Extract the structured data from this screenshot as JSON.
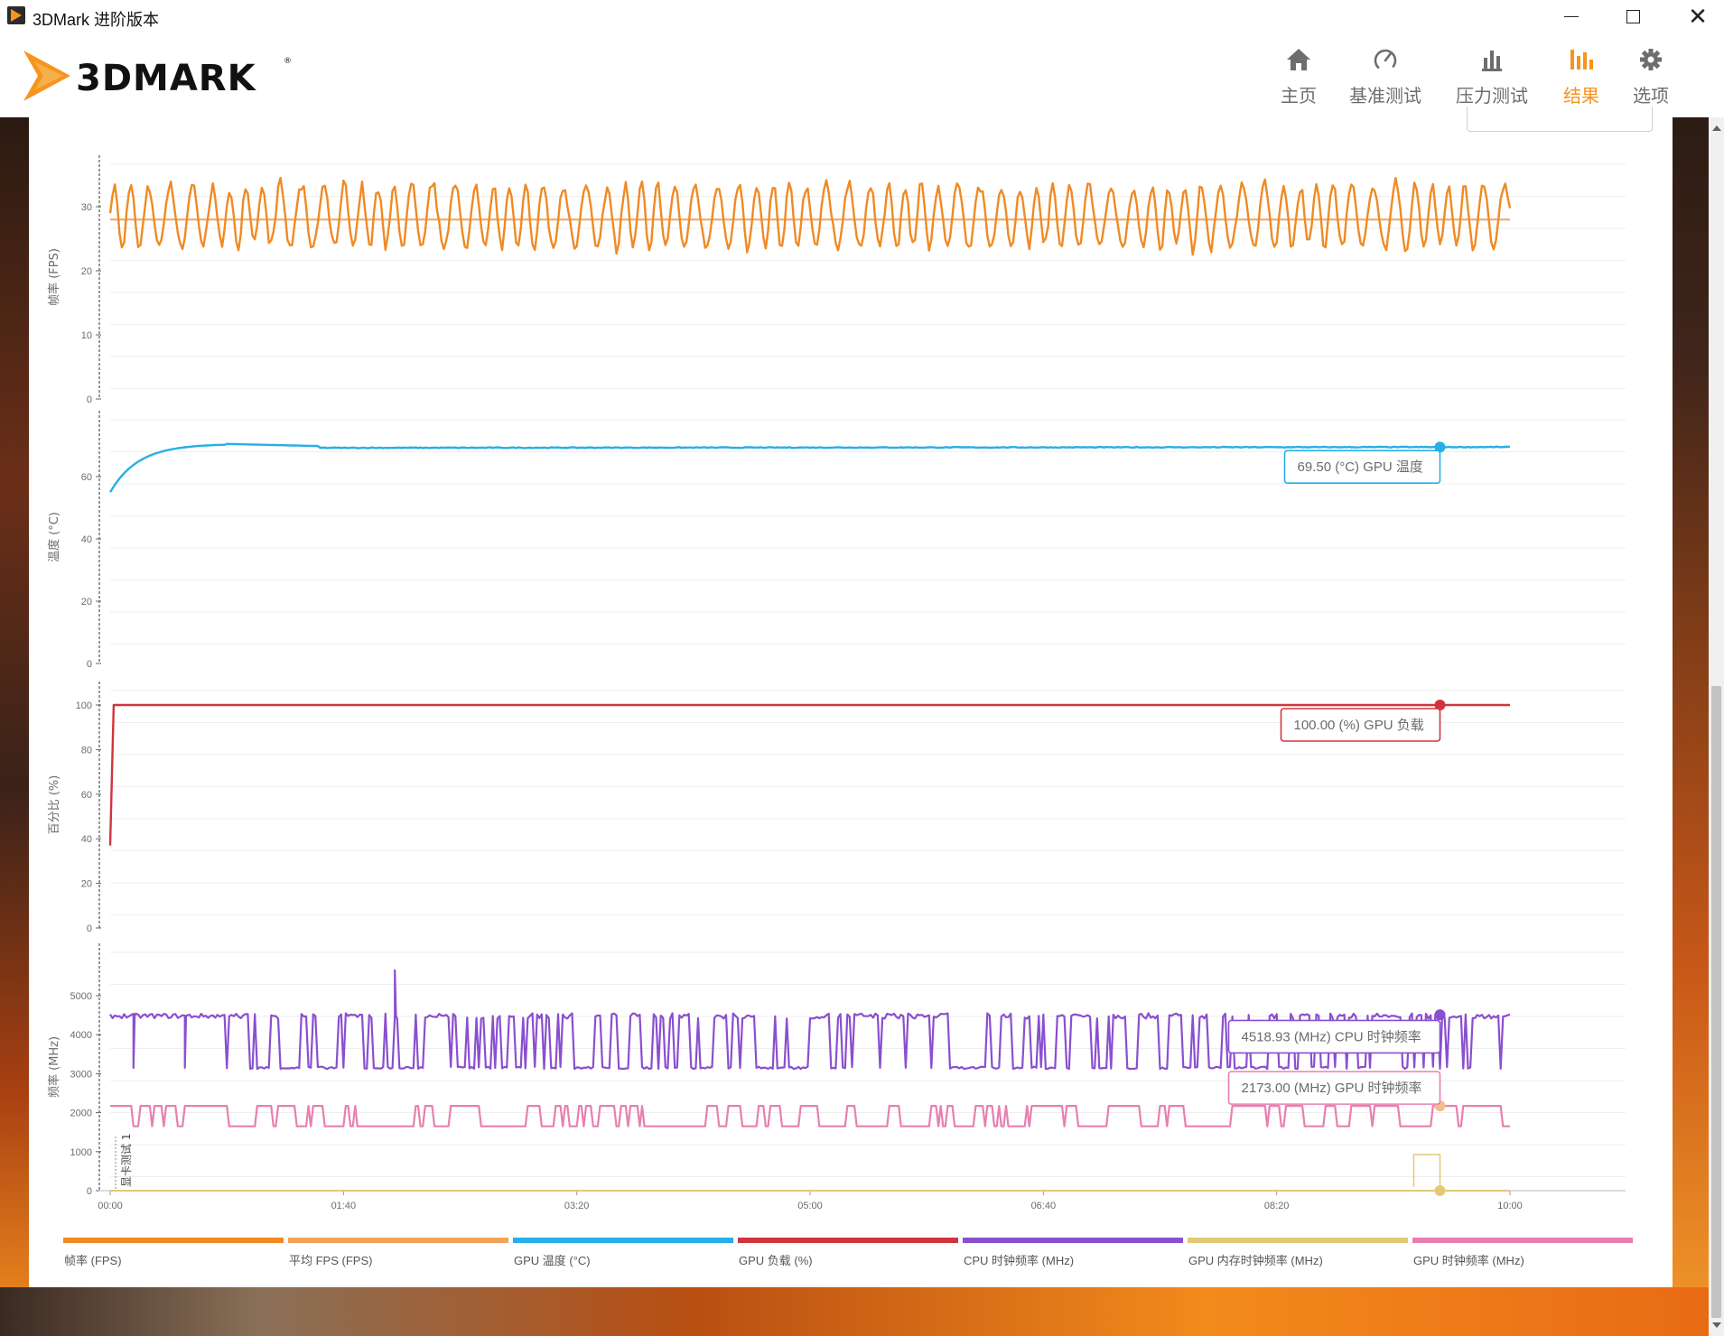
{
  "window": {
    "title": "3DMark 进阶版本"
  },
  "nav": {
    "items": [
      {
        "label": "主页",
        "icon": "home-icon"
      },
      {
        "label": "基准测试",
        "icon": "gauge-icon"
      },
      {
        "label": "压力测试",
        "icon": "bar-chart-icon"
      },
      {
        "label": "结果",
        "icon": "results-icon",
        "active": true
      },
      {
        "label": "选项",
        "icon": "gear-icon"
      }
    ],
    "active_color": "#f7941d"
  },
  "chart_data": {
    "type": "line",
    "x_ticks": [
      "00:00",
      "01:40",
      "03:20",
      "05:00",
      "06:40",
      "08:20",
      "10:00"
    ],
    "xlim_seconds": [
      0,
      600
    ],
    "panels": [
      {
        "ylabel": "帧率 (FPS)",
        "yticks": [
          0,
          10,
          20,
          30
        ],
        "ylim": [
          0,
          30
        ],
        "series": [
          {
            "name": "帧率 (FPS)",
            "color": "#f08a24",
            "pattern": "oscillating",
            "min": 23,
            "max": 34
          },
          {
            "name": "平均 FPS (FPS)",
            "color": "#f5a25a",
            "pattern": "flat",
            "value": 28
          }
        ]
      },
      {
        "ylabel": "温度 (°C)",
        "yticks": [
          0,
          20,
          40,
          60
        ],
        "ylim": [
          0,
          70
        ],
        "series": [
          {
            "name": "GPU 温度 (°C)",
            "color": "#29aee6",
            "pattern": "warmup",
            "start": 55,
            "peak": 70.5,
            "value": 69.5
          }
        ]
      },
      {
        "ylabel": "百分比 (%)",
        "yticks": [
          0,
          20,
          40,
          60,
          80,
          100
        ],
        "ylim": [
          0,
          100
        ],
        "series": [
          {
            "name": "GPU 负载 (%)",
            "color": "#d0353d",
            "pattern": "step",
            "start": 37,
            "value": 100
          }
        ]
      },
      {
        "ylabel": "频率 (MHz)",
        "yticks": [
          0,
          1000,
          2000,
          3000,
          4000,
          5000
        ],
        "ylim": [
          0,
          5000
        ],
        "series": [
          {
            "name": "CPU 时钟频率 (MHz)",
            "color": "#8a4fd0",
            "pattern": "square",
            "low": 3150,
            "high": 4480,
            "spike": 5650
          },
          {
            "name": "GPU 时钟频率 (MHz)",
            "color": "#e87fb0",
            "pattern": "square",
            "low": 1650,
            "high": 2173
          },
          {
            "name": "GPU 内存时钟频率 (MHz)",
            "color": "#e3c878",
            "pattern": "flat",
            "value": 0
          }
        ],
        "marker": {
          "label": "显卡测试 1"
        }
      }
    ],
    "tooltips": [
      {
        "text": "69.50 (°C) GPU 温度",
        "color": "#29aee6"
      },
      {
        "text": "100.00 (%) GPU 负载",
        "color": "#d0353d"
      },
      {
        "text": "4518.93 (MHz) CPU 时钟频率",
        "color": "#8a4fd0"
      },
      {
        "text": "2173.00 (MHz) GPU 时钟频率",
        "color": "#e87fb0"
      }
    ],
    "legend": [
      {
        "name": "帧率 (FPS)",
        "color": "#f08a24"
      },
      {
        "name": "平均 FPS (FPS)",
        "color": "#f5a25a"
      },
      {
        "name": "GPU 温度 (°C)",
        "color": "#29aee6"
      },
      {
        "name": "GPU 负载 (%)",
        "color": "#d0353d"
      },
      {
        "name": "CPU 时钟频率 (MHz)",
        "color": "#8a4fd0"
      },
      {
        "name": "GPU 内存时钟频率 (MHz)",
        "color": "#e3c878"
      },
      {
        "name": "GPU 时钟频率 (MHz)",
        "color": "#e87fb0"
      }
    ]
  }
}
